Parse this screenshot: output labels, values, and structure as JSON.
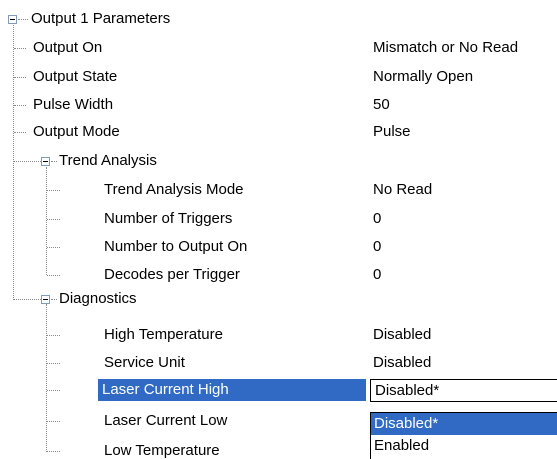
{
  "tree": {
    "root": {
      "label": "Output 1 Parameters"
    },
    "rows": [
      {
        "label": "Output On",
        "value": "Mismatch or No Read"
      },
      {
        "label": "Output State",
        "value": "Normally Open"
      },
      {
        "label": "Pulse Width",
        "value": "50"
      },
      {
        "label": "Output Mode",
        "value": "Pulse"
      }
    ],
    "trend": {
      "label": "Trend Analysis",
      "rows": [
        {
          "label": "Trend Analysis Mode",
          "value": "No Read"
        },
        {
          "label": "Number of Triggers",
          "value": "0"
        },
        {
          "label": "Number to Output On",
          "value": "0"
        },
        {
          "label": "Decodes per Trigger",
          "value": "0"
        }
      ]
    },
    "diag": {
      "label": "Diagnostics",
      "rows": [
        {
          "label": "High Temperature",
          "value": "Disabled"
        },
        {
          "label": "Service Unit",
          "value": "Disabled"
        },
        {
          "label": "Laser Current High",
          "value": "Disabled*"
        },
        {
          "label": "Laser Current Low"
        },
        {
          "label": "Low Temperature"
        }
      ]
    }
  },
  "dropdown": {
    "options": [
      "Disabled*",
      "Enabled"
    ],
    "highlighted_index": 0
  },
  "colors": {
    "selection": "#316ac5",
    "guide_lines": "#8a8a8a",
    "toggle_border": "#7f9db9"
  }
}
